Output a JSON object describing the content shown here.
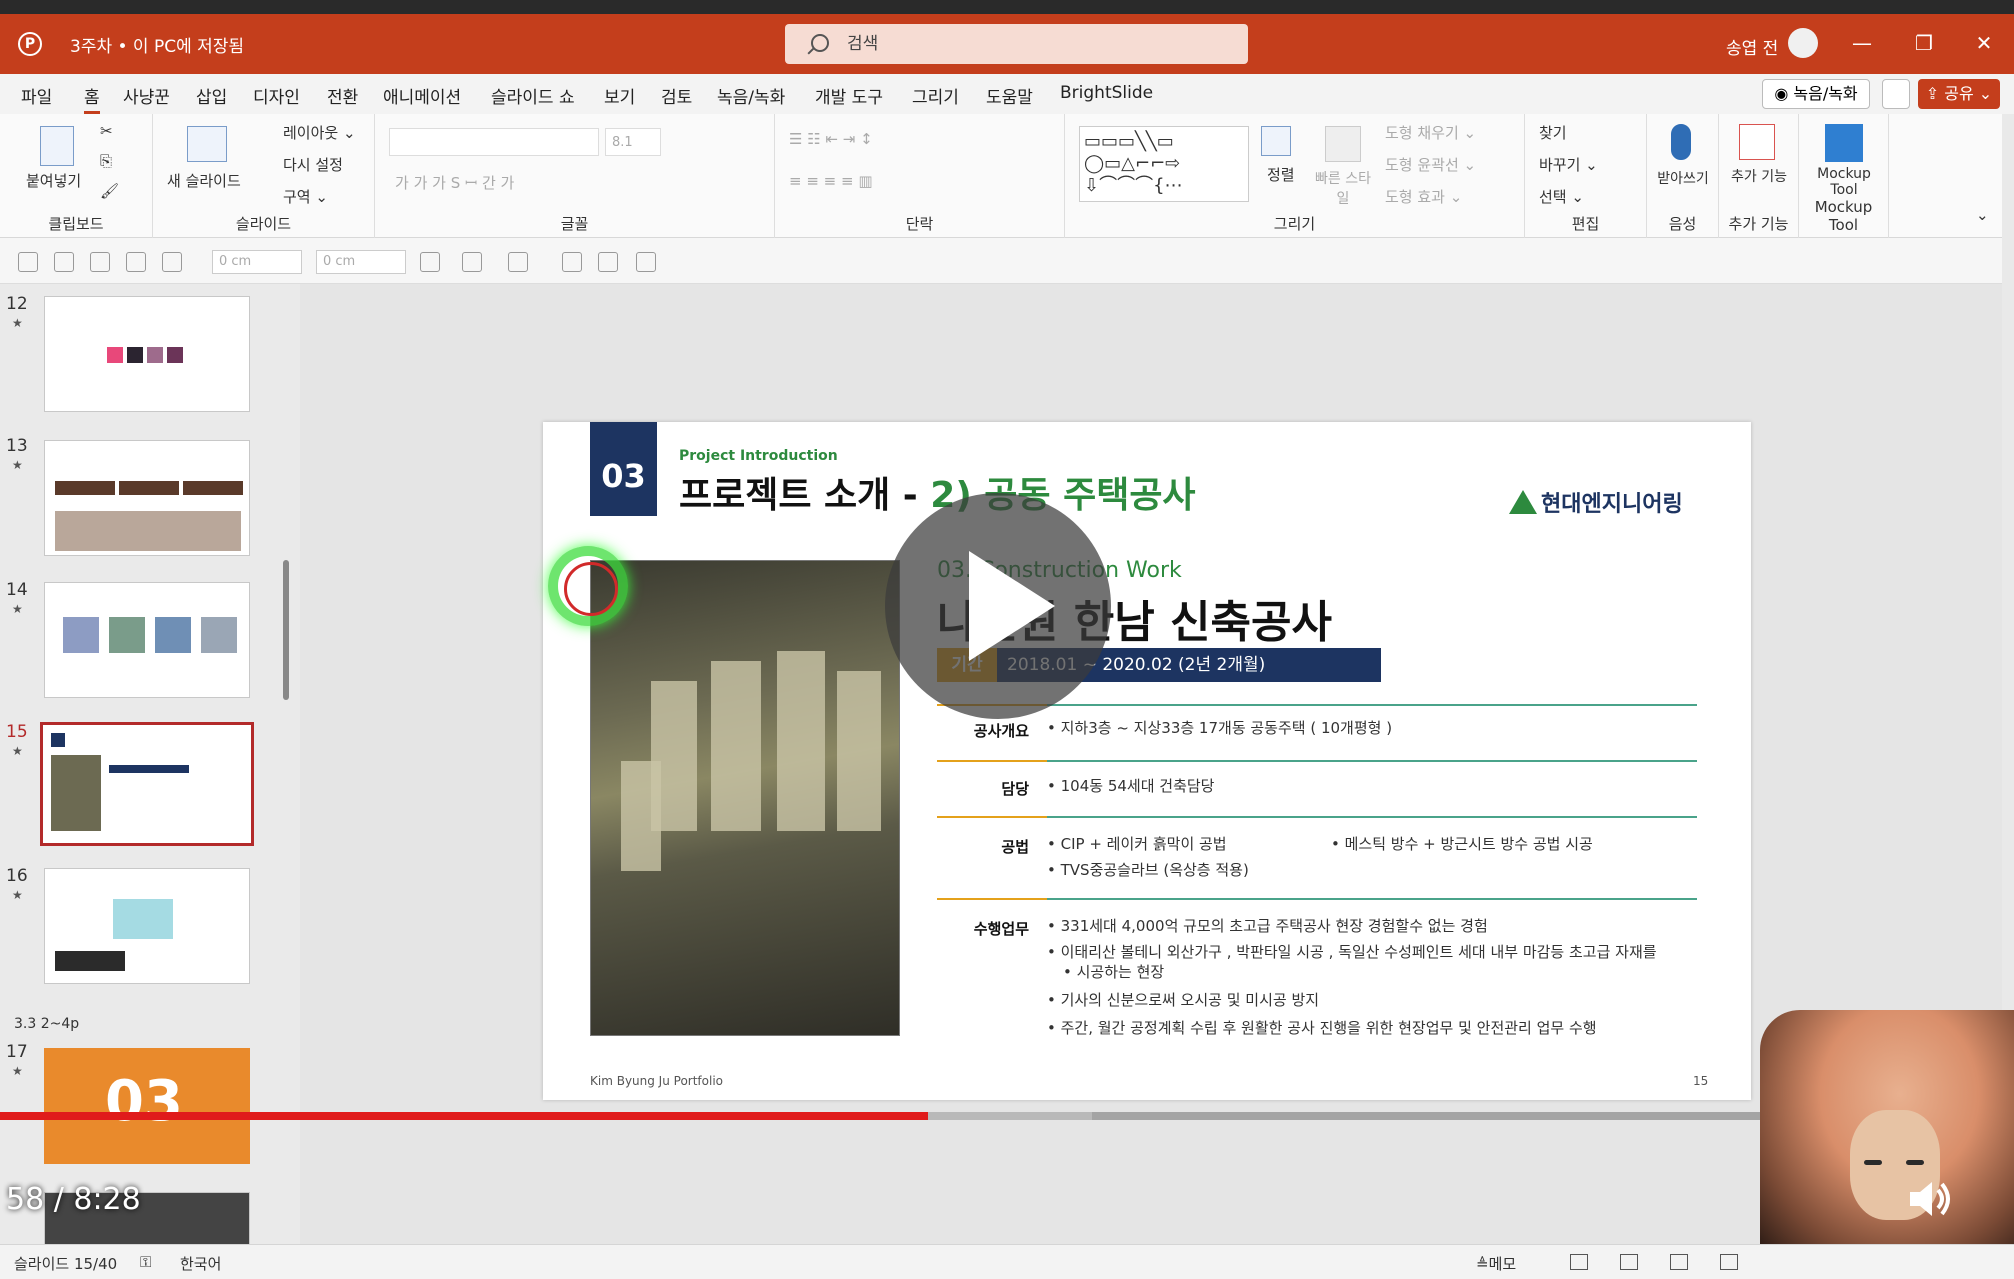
{
  "titlebar": {
    "doc_title": "3주차 • 이 PC에 저장됨",
    "search_placeholder": "검색",
    "user_name": "송엽 전",
    "minimize": "—",
    "restore": "❐",
    "close": "✕"
  },
  "menu": {
    "items": [
      "파일",
      "홈",
      "사냥꾼",
      "삽입",
      "디자인",
      "전환",
      "애니메이션",
      "슬라이드 쇼",
      "보기",
      "검토",
      "녹음/녹화",
      "개발 도구",
      "그리기",
      "도움말",
      "BrightSlide"
    ],
    "active": "홈",
    "record_label": "◉ 녹음/녹화",
    "share_label": "⇪ 공유 ⌄"
  },
  "ribbon": {
    "clipboard": {
      "paste": "붙여넣기",
      "label": "클립보드"
    },
    "slides": {
      "new_slide": "새 슬라이드",
      "layout": "레이아웃 ⌄",
      "reset": "다시 설정",
      "section": "구역 ⌄",
      "label": "슬라이드"
    },
    "font": {
      "size": "8.1",
      "label": "글꼴"
    },
    "paragraph": {
      "label": "단락"
    },
    "drawing": {
      "arrange": "정렬",
      "quick_styles": "빠른 스타일",
      "fill": "도형 채우기 ⌄",
      "outline": "도형 윤곽선 ⌄",
      "effects": "도형 효과 ⌄",
      "label": "그리기"
    },
    "editing": {
      "find": "찾기",
      "replace": "바꾸기 ⌄",
      "select": "선택 ⌄",
      "label": "편집"
    },
    "voice": {
      "dictate": "받아쓰기",
      "label": "음성"
    },
    "addins": {
      "addins": "추가 기능",
      "label": "추가 기능"
    },
    "mockup": {
      "tool": "Mockup Tool",
      "label": "Mockup Tool"
    }
  },
  "format_bar": {
    "height": "0 cm",
    "width": "0 cm"
  },
  "thumbnails": [
    {
      "num": "12",
      "active": false
    },
    {
      "num": "13",
      "active": false
    },
    {
      "num": "14",
      "active": false
    },
    {
      "num": "15",
      "active": true
    },
    {
      "num": "16",
      "active": false
    },
    {
      "num": "17",
      "active": false
    }
  ],
  "section_label": "3.3 2~4p",
  "thumb17_text": "03",
  "slide": {
    "badge": "03",
    "kicker": "Project Introduction",
    "title_black": "프로젝트 소개 - ",
    "title_green": "2) 공동 주택공사",
    "logo": "현대엔지니어링",
    "subtitle": "03. Construction Work",
    "project_name": "나인원 한남 신축공사",
    "period_label": "기간",
    "period_value": "2018.01 ~ 2020.02 (2년 2개월)",
    "rows": [
      {
        "label": "공사개요",
        "items": [
          "지하3층 ~ 지상33층 17개동 공동주택 ( 10개평형 )"
        ]
      },
      {
        "label": "담당",
        "items": [
          "104동 54세대 건축담당"
        ]
      },
      {
        "label": "공법",
        "items": [
          "CIP + 레이커 흙막이 공법",
          "TVS중공슬라브 (옥상층 적용)",
          "메스틱 방수 + 방근시트 방수 공법 시공"
        ]
      },
      {
        "label": "수행업무",
        "items": [
          "331세대 4,000억 규모의 초고급 주택공사 현장 경험할수 없는 경험",
          "이태리산 볼테니 외산가구 , 박판타일 시공 , 독일산 수성페인트 세대 내부 마감등 초고급 자재를",
          "시공하는 현장",
          "기사의 신분으로써 오시공 및 미시공 방지",
          "주간, 월간 공정계획 수립 후 원활한 공사 진행을 위한 현장업무 및 안전관리 업무 수행"
        ]
      }
    ],
    "footer": "Kim Byung Ju Portfolio",
    "page": "15"
  },
  "video": {
    "time": "58  /  8:28",
    "progress": 0.4608,
    "buffered": 0.5422
  },
  "status": {
    "slide": "슬라이드 15/40",
    "lang": "한국어",
    "notes": "≜메모"
  }
}
